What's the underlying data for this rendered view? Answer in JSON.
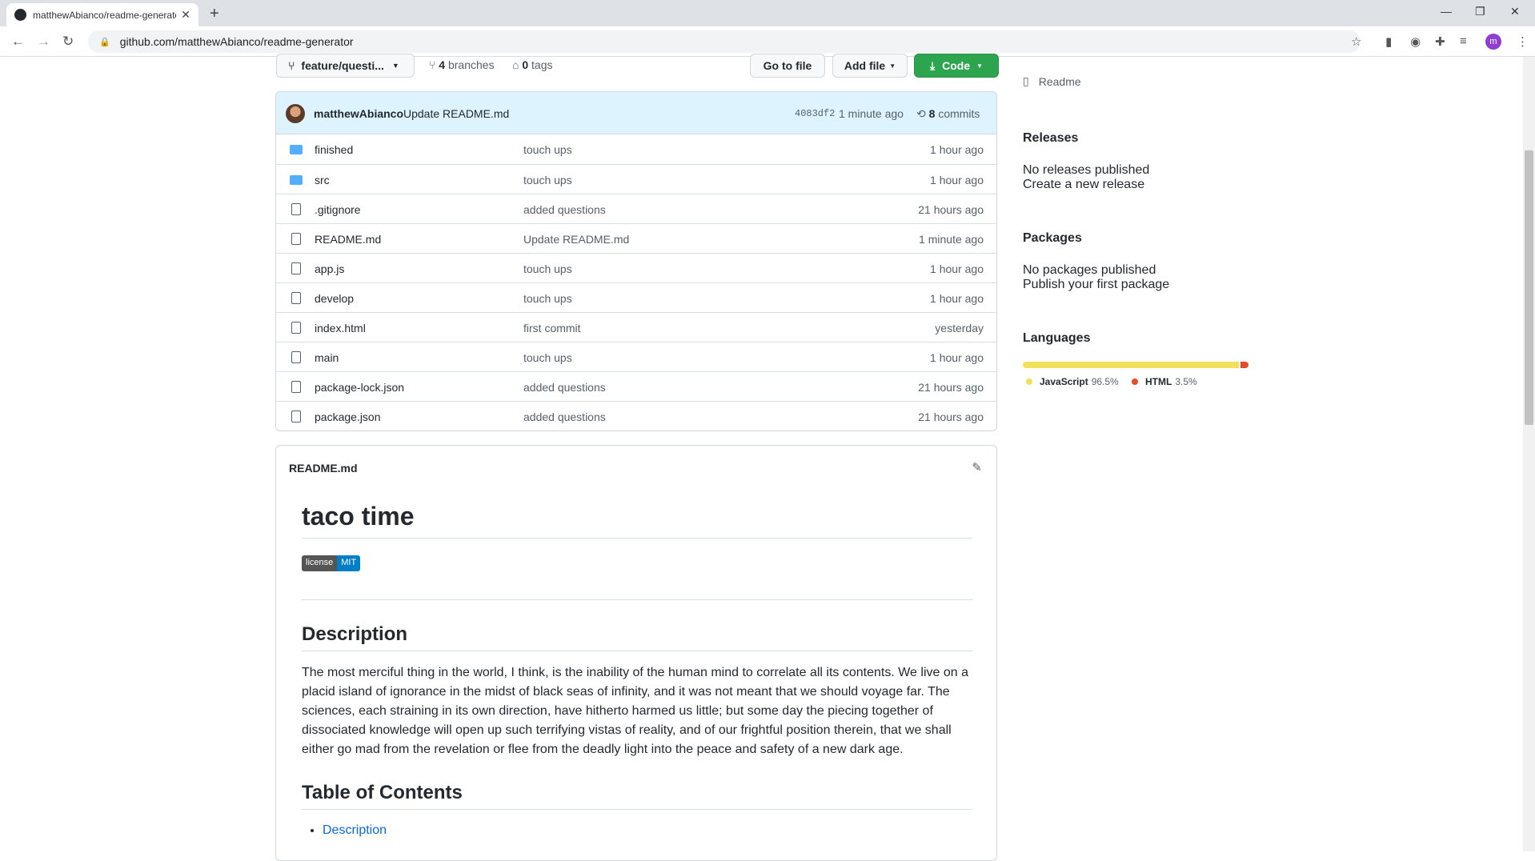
{
  "browser": {
    "tab_title": "matthewAbianco/readme-generator",
    "url": "github.com/matthewAbianco/readme-generator",
    "profile_initial": "m"
  },
  "repo": {
    "branch": "feature/questi...",
    "branches_count": "4",
    "branches_label": "branches",
    "tags_count": "0",
    "tags_label": "tags",
    "go_to_file": "Go to file",
    "add_file": "Add file",
    "code": "Code"
  },
  "latest_commit": {
    "author": "matthewAbianco",
    "message": "Update README.md",
    "sha": "4083df2",
    "time": "1 minute ago",
    "commits_count": "8",
    "commits_label": "commits"
  },
  "files": [
    {
      "type": "folder",
      "name": "finished",
      "message": "touch ups",
      "age": "1 hour ago"
    },
    {
      "type": "folder",
      "name": "src",
      "message": "touch ups",
      "age": "1 hour ago"
    },
    {
      "type": "file",
      "name": ".gitignore",
      "message": "added questions",
      "age": "21 hours ago"
    },
    {
      "type": "file",
      "name": "README.md",
      "message": "Update README.md",
      "age": "1 minute ago"
    },
    {
      "type": "file",
      "name": "app.js",
      "message": "touch ups",
      "age": "1 hour ago"
    },
    {
      "type": "file",
      "name": "develop",
      "message": "touch ups",
      "age": "1 hour ago"
    },
    {
      "type": "file",
      "name": "index.html",
      "message": "first commit",
      "age": "yesterday"
    },
    {
      "type": "file",
      "name": "main",
      "message": "touch ups",
      "age": "1 hour ago"
    },
    {
      "type": "file",
      "name": "package-lock.json",
      "message": "added questions",
      "age": "21 hours ago"
    },
    {
      "type": "file",
      "name": "package.json",
      "message": "added questions",
      "age": "21 hours ago"
    }
  ],
  "readme": {
    "header": "README.md",
    "title": "taco time",
    "badge_left": "license",
    "badge_right": "MIT",
    "description_heading": "Description",
    "description": "The most merciful thing in the world, I think, is the inability of the human mind to correlate all its contents. We live on a placid island of ignorance in the midst of black seas of infinity, and it was not meant that we should voyage far. The sciences, each straining in its own direction, have hitherto harmed us little; but some day the piecing together of dissociated knowledge will open up such terrifying vistas of reality, and of our frightful position therein, that we shall either go mad from the revelation or flee from the deadly light into the peace and safety of a new dark age.",
    "toc_heading": "Table of Contents",
    "toc": [
      "Description"
    ]
  },
  "sidebar": {
    "readme_link": "Readme",
    "releases_title": "Releases",
    "releases_none": "No releases published",
    "releases_link": "Create a new release",
    "packages_title": "Packages",
    "packages_none": "No packages published",
    "packages_link": "Publish your first package",
    "languages_title": "Languages",
    "languages": [
      {
        "name": "JavaScript",
        "percent": "96.5%",
        "value": 96.5,
        "color": "#f1e05a"
      },
      {
        "name": "HTML",
        "percent": "3.5%",
        "value": 3.5,
        "color": "#e34c26"
      }
    ]
  }
}
